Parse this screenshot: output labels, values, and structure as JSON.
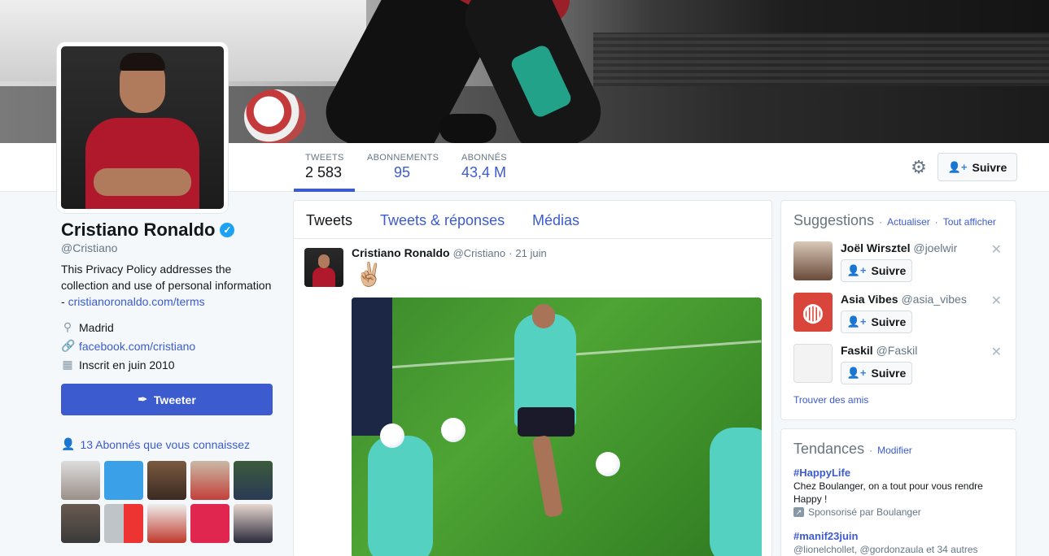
{
  "stats": [
    {
      "label": "TWEETS",
      "value": "2 583"
    },
    {
      "label": "ABONNEMENTS",
      "value": "95"
    },
    {
      "label": "ABONNÉS",
      "value": "43,4 M"
    }
  ],
  "header": {
    "follow_label": "Suivre"
  },
  "profile": {
    "name": "Cristiano Ronaldo",
    "handle": "@Cristiano",
    "bio_text": "This Privacy Policy addresses the collection and use of personal information - ",
    "bio_link": "cristianoronaldo.com/terms",
    "location": "Madrid",
    "website": "facebook.com/cristiano",
    "joined": "Inscrit en juin 2010",
    "tweet_button": "Tweeter",
    "followers_you_know": "13 Abonnés que vous connaissez"
  },
  "timeline": {
    "tabs": [
      "Tweets",
      "Tweets & réponses",
      "Médias"
    ],
    "tweet": {
      "name": "Cristiano Ronaldo",
      "handle": "@Cristiano",
      "sep": "·",
      "date": "21 juin",
      "text": "✌🏼"
    }
  },
  "suggestions": {
    "title": "Suggestions",
    "sep1": "·",
    "refresh": "Actualiser",
    "sep2": "·",
    "view_all": "Tout afficher",
    "items": [
      {
        "name": "Joël Wirsztel",
        "handle": "@joelwir",
        "button": "Suivre"
      },
      {
        "name": "Asia Vibes",
        "handle": "@asia_vibes",
        "button": "Suivre"
      },
      {
        "name": "Faskil",
        "handle": "@Faskil",
        "button": "Suivre"
      }
    ],
    "find_friends": "Trouver des amis"
  },
  "trends": {
    "title": "Tendances",
    "sep": "·",
    "modify": "Modifier",
    "items": [
      {
        "tag": "#HappyLife",
        "desc": "Chez Boulanger, on a tout pour vous rendre Happy !",
        "sponsor": "Sponsorisé par Boulanger"
      },
      {
        "tag": "#manif23juin",
        "sub": "@lionelchollet, @gordonzaula et 34 autres"
      }
    ]
  },
  "colors": {
    "accent": "#3b5bcf",
    "verified": "#1da1f2"
  },
  "icons": {
    "settings": "gear-icon",
    "follow": "person-plus-icon",
    "verified": "verified-badge-icon",
    "location": "map-pin-icon",
    "link": "link-icon",
    "calendar": "calendar-icon",
    "feather": "feather-icon",
    "close": "close-icon"
  }
}
